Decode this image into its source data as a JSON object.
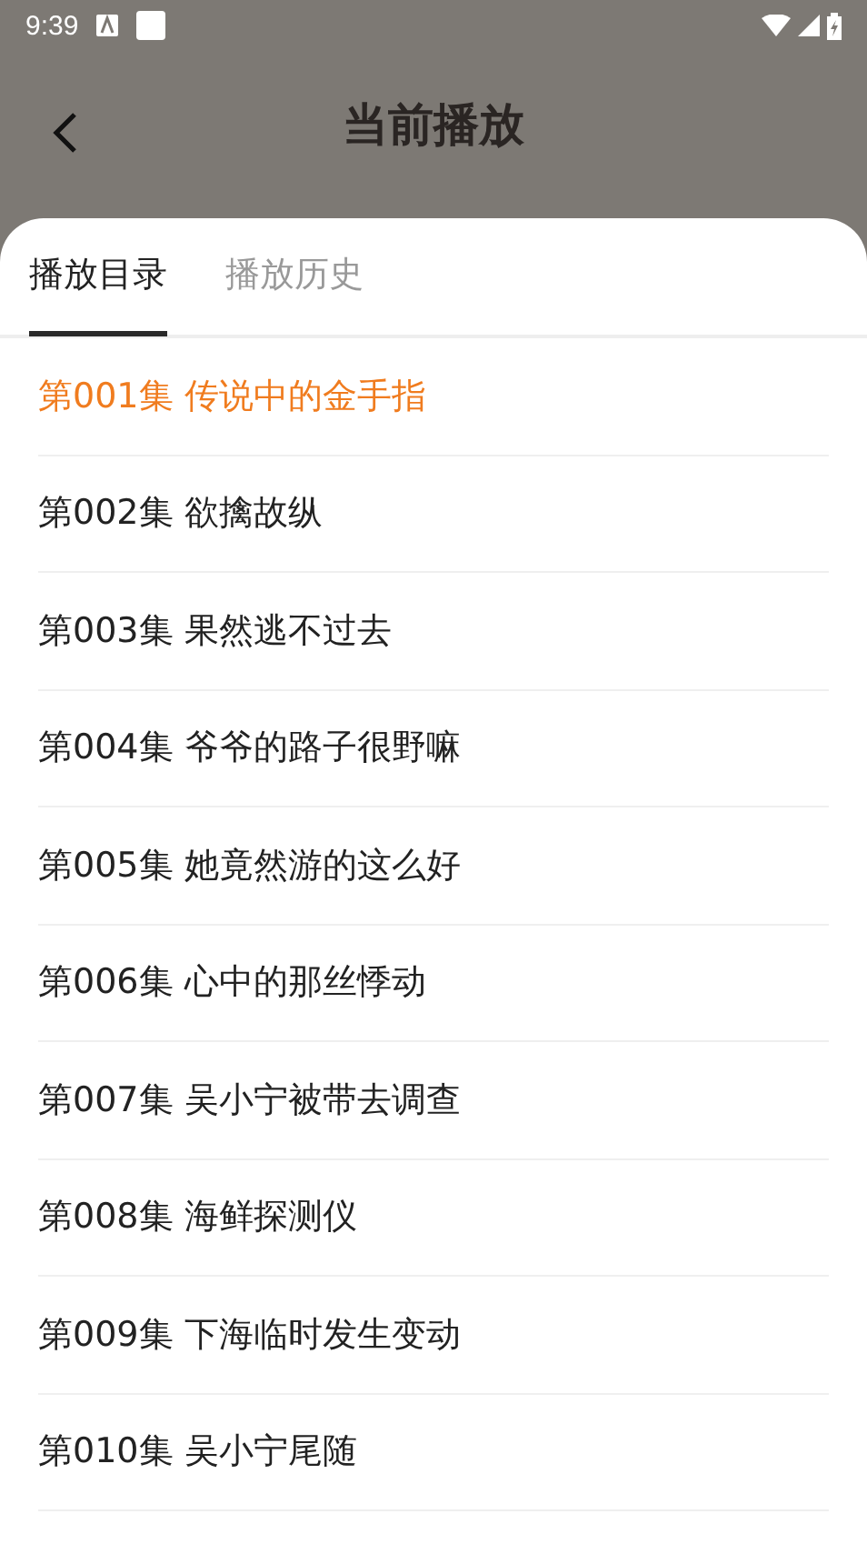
{
  "status_bar": {
    "time": "9:39"
  },
  "header": {
    "title": "当前播放"
  },
  "tabs": [
    {
      "label": "播放目录",
      "selected": true
    },
    {
      "label": "播放历史",
      "selected": false
    }
  ],
  "episodes": [
    {
      "label": "第001集 传说中的金手指",
      "selected": true
    },
    {
      "label": "第002集 欲擒故纵",
      "selected": false
    },
    {
      "label": "第003集 果然逃不过去",
      "selected": false
    },
    {
      "label": "第004集 爷爷的路子很野嘛",
      "selected": false
    },
    {
      "label": "第005集 她竟然游的这么好",
      "selected": false
    },
    {
      "label": "第006集 心中的那丝悸动",
      "selected": false
    },
    {
      "label": "第007集 吴小宁被带去调查",
      "selected": false
    },
    {
      "label": "第008集 海鲜探测仪",
      "selected": false
    },
    {
      "label": "第009集 下海临时发生变动",
      "selected": false
    },
    {
      "label": "第010集 吴小宁尾随",
      "selected": false
    }
  ]
}
